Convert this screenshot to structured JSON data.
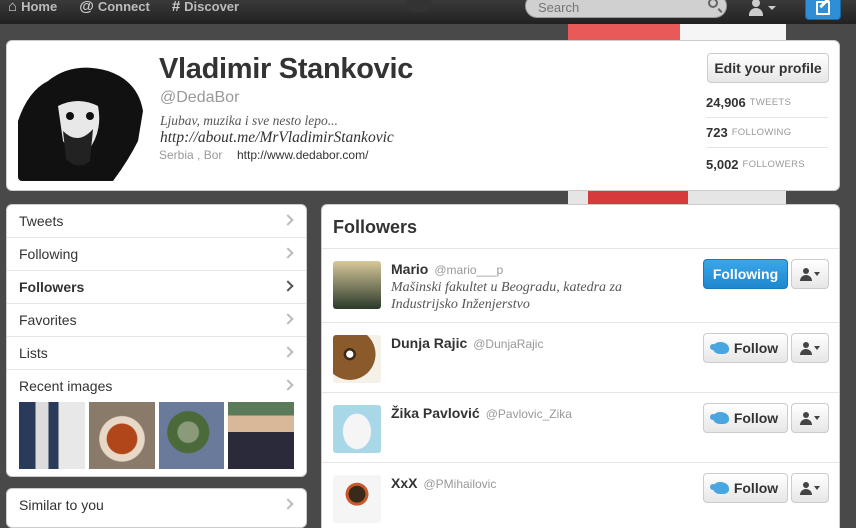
{
  "nav": {
    "home": "Home",
    "connect": "Connect",
    "discover": "Discover",
    "search_placeholder": "Search"
  },
  "profile": {
    "name": "Vladimir Stankovic",
    "handle": "@DedaBor",
    "bio": "Ljubav, muzika i sve nesto lepo...",
    "bio_link": "http://about.me/MrVladimirStankovic",
    "location": "Serbia , Bor",
    "website": "http://www.dedabor.com/",
    "edit_button": "Edit your profile",
    "stats": [
      {
        "num": "24,906",
        "label": "TWEETS"
      },
      {
        "num": "723",
        "label": "FOLLOWING"
      },
      {
        "num": "5,002",
        "label": "FOLLOWERS"
      }
    ]
  },
  "sidebar": {
    "items": [
      {
        "label": "Tweets"
      },
      {
        "label": "Following"
      },
      {
        "label": "Followers"
      },
      {
        "label": "Favorites"
      },
      {
        "label": "Lists"
      }
    ],
    "recent_images": "Recent images",
    "similar": "Similar to you"
  },
  "followers": {
    "title": "Followers",
    "list": [
      {
        "name": "Mario",
        "handle": "@mario___p",
        "bio_line1": "Mašinski fakultet u Beogradu, katedra za",
        "bio_line2": "Industrijsko Inženjerstvo",
        "button": "Following"
      },
      {
        "name": "Dunja Rajic",
        "handle": "@DunjaRajic",
        "button": "Follow"
      },
      {
        "name": "Žika Pavlović",
        "handle": "@Pavlovic_Zika",
        "button": "Follow"
      },
      {
        "name": "XxX",
        "handle": "@PMihailovic",
        "button": "Follow"
      }
    ]
  },
  "colors": {
    "accent": "#2f8ed6",
    "following_button": "#2a97dd"
  }
}
